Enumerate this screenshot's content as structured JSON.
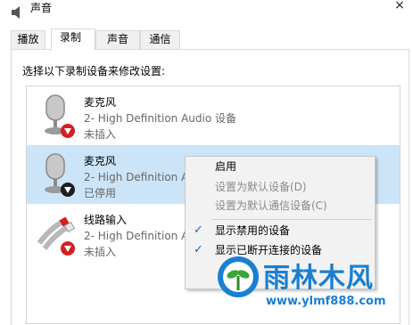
{
  "window": {
    "title": "声音",
    "close_glyph": "×"
  },
  "tabs": [
    {
      "label": "播放",
      "active": false
    },
    {
      "label": "录制",
      "active": true
    },
    {
      "label": "声音",
      "active": false
    },
    {
      "label": "通信",
      "active": false
    }
  ],
  "instruction": "选择以下录制设备来修改设置:",
  "devices": [
    {
      "name": "麦克风",
      "description": "2- High Definition Audio 设备",
      "status": "未插入",
      "icon": "microphone-icon",
      "badge": "red-down-arrow-icon"
    },
    {
      "name": "麦克风",
      "description": "2- High Definition Audio 设备",
      "status": "已停用",
      "icon": "microphone-icon",
      "badge": "black-down-arrow-icon",
      "selected": true
    },
    {
      "name": "线路输入",
      "description": "2- High Definition Audio 设备",
      "status": "未插入",
      "icon": "line-in-icon",
      "badge": "red-down-arrow-icon"
    }
  ],
  "context_menu": {
    "items": [
      {
        "label": "启用",
        "disabled": false,
        "checked": false
      },
      {
        "label": "设置为默认设备(D)",
        "disabled": true,
        "checked": false
      },
      {
        "label": "设置为默认通信设备(C)",
        "disabled": true,
        "checked": false
      },
      {
        "label": "显示禁用的设备",
        "disabled": false,
        "checked": true
      },
      {
        "label": "显示已断开连接的设备",
        "disabled": false,
        "checked": true
      }
    ],
    "check_glyph": "✓"
  },
  "watermark": {
    "title": "雨林木风",
    "url": "www.ylmf888.com"
  },
  "colors": {
    "selection": "#cce4f7",
    "watermark_blue": "#1a7fd1",
    "badge_red": "#d42020"
  }
}
